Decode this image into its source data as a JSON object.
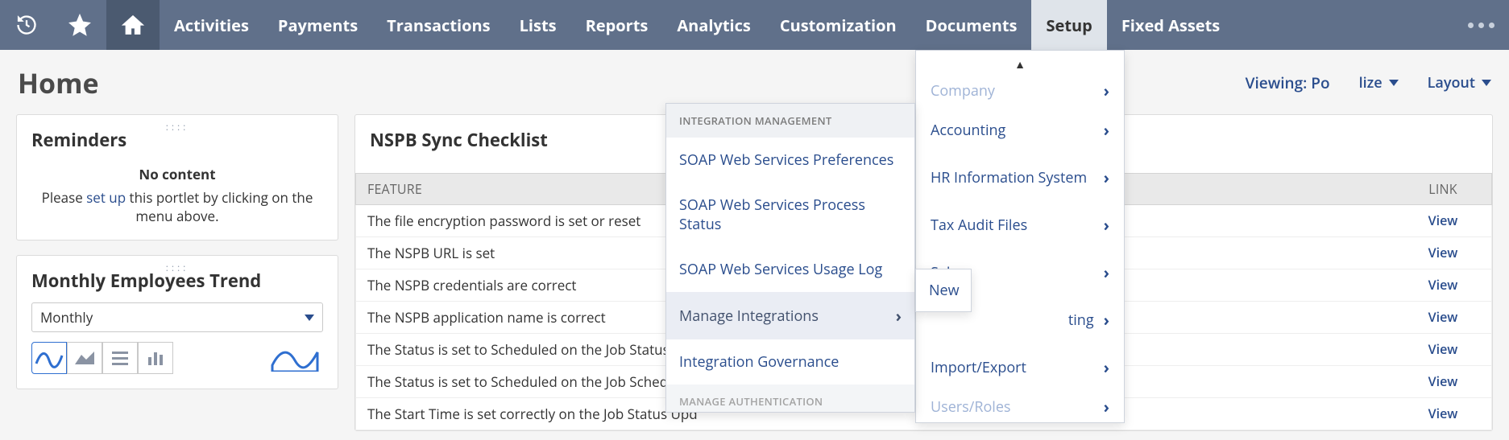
{
  "nav": {
    "items": [
      "Activities",
      "Payments",
      "Transactions",
      "Lists",
      "Reports",
      "Analytics",
      "Customization",
      "Documents",
      "Setup",
      "Fixed Assets"
    ],
    "open_index": 8
  },
  "header": {
    "title": "Home",
    "viewing_prefix": "Viewing: Po",
    "personalize_suffix": "lize",
    "layout": "Layout"
  },
  "reminders": {
    "title": "Reminders",
    "no_content": "No content",
    "text_before": "Please ",
    "setup_link": "set up",
    "text_after": " this portlet by clicking on the menu above."
  },
  "trend": {
    "title": "Monthly Employees Trend",
    "select_value": "Monthly"
  },
  "checklist": {
    "title": "NSPB Sync Checklist",
    "columns": {
      "feature": "FEATURE",
      "link": "LINK"
    },
    "link_label": "View",
    "rows": [
      "The file encryption password is set or reset",
      "The NSPB URL is set",
      "The NSPB credentials are correct",
      "The NSPB application name is correct",
      "The Status is set to Scheduled on the Job Status Upd",
      "The Status is set to Scheduled on the Job Scheduler",
      "The Start Time is set correctly on the Job Status Upd"
    ]
  },
  "setup_menu": {
    "cutoff_top": "Company",
    "items": [
      "Accounting",
      "HR Information System",
      "Tax Audit Files",
      "Sales",
      "ting",
      "Import/Export"
    ],
    "cutoff_bottom": "Users/Roles"
  },
  "integration_menu": {
    "section1": "INTEGRATION MANAGEMENT",
    "items1": [
      {
        "label": "SOAP Web Services Preferences",
        "has_sub": false
      },
      {
        "label": "SOAP Web Services Process Status",
        "has_sub": false
      },
      {
        "label": "SOAP Web Services Usage Log",
        "has_sub": false
      },
      {
        "label": "Manage Integrations",
        "has_sub": true,
        "hover": true
      },
      {
        "label": "Integration Governance",
        "has_sub": false
      }
    ],
    "section2": "MANAGE AUTHENTICATION"
  },
  "new_menu": {
    "label": "New"
  }
}
